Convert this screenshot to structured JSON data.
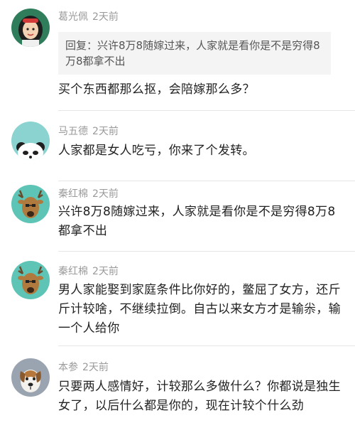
{
  "comments": [
    {
      "author": "葛光佩",
      "time": "2天前",
      "avatar": "cartoon-girl-icon",
      "reply_label": "回复：",
      "reply_text": "兴许8万8随嫁过来，人家就是看你是不是穷得8万8都拿不出",
      "body": "买个东西都那么抠，会陪嫁那么多？"
    },
    {
      "author": "马五德",
      "time": "2天前",
      "avatar": "panda-icon",
      "body": "人家都是女人吃亏，你来了个发转。"
    },
    {
      "author": "秦红棉",
      "time": "2天前",
      "avatar": "deer-icon",
      "body": "兴许8万8随嫁过来，人家就是看你是不是穷得8万8都拿不出"
    },
    {
      "author": "秦红棉",
      "time": "2天前",
      "avatar": "deer-icon",
      "body": "男人家能娶到家庭条件比你好的，鳖屈了女方，还斤斤计较啥，不继续拉倒。自古以来女方才是输尜，输一个人给你"
    },
    {
      "author": "本参",
      "time": "2天前",
      "avatar": "dog-icon",
      "body": "只要两人感情好，计较那么多做什么？你都说是独生女了，以后什么都是你的，现在计较个什么劲"
    }
  ],
  "colors": {
    "meta": "#9a9a9a",
    "text": "#222222",
    "reply_bg": "#f4f4f4",
    "divider": "#e6e6e6"
  }
}
